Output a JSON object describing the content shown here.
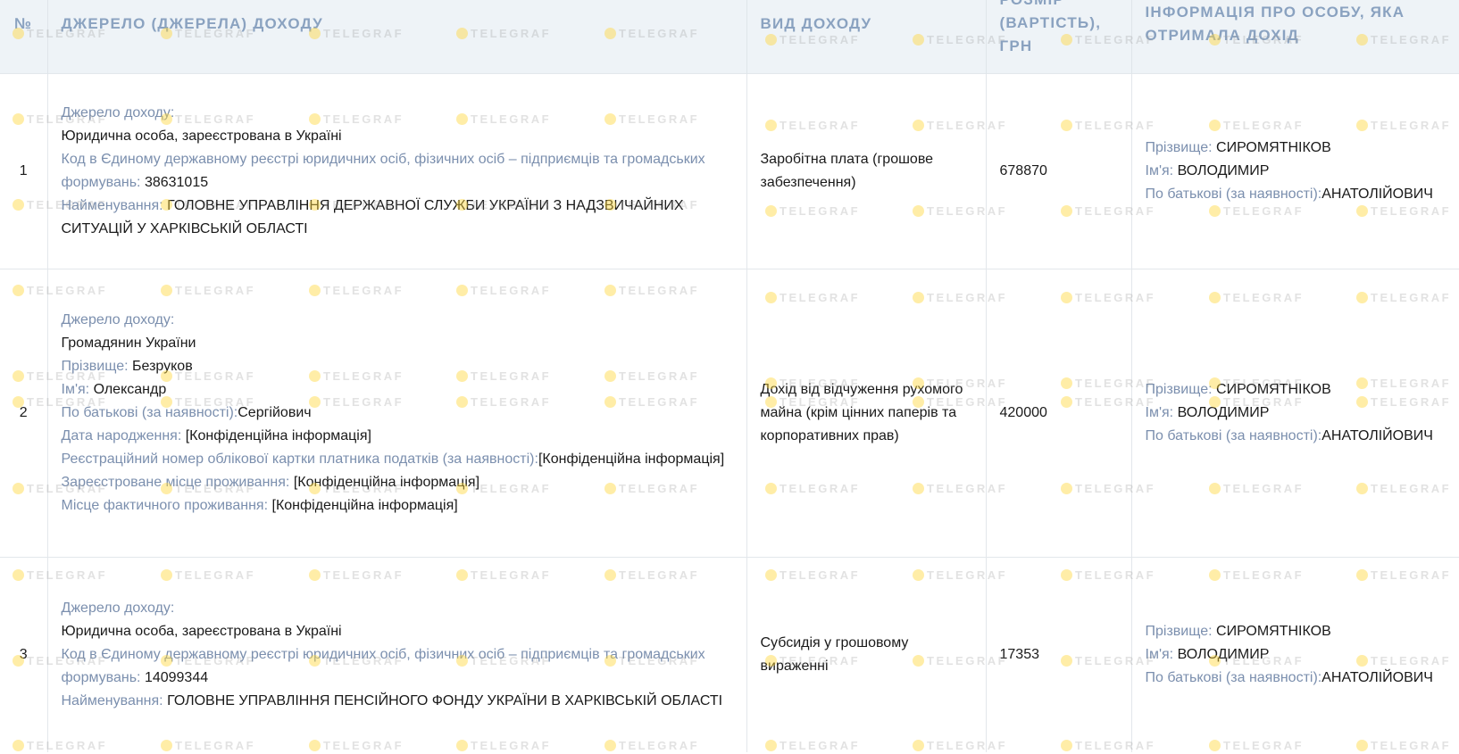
{
  "headers": {
    "num": "№",
    "source": "ДЖЕРЕЛО (ДЖЕРЕЛА) ДОХОДУ",
    "type": "ВИД ДОХОДУ",
    "amount": "РОЗМІР (ВАРТІСТЬ), ГРН",
    "person": "ІНФОРМАЦІЯ ПРО ОСОБУ, ЯКА ОТРИМАЛА ДОХІД"
  },
  "watermark": "TELEGRAF",
  "rows": [
    {
      "num": "1",
      "source": {
        "label_source": "Джерело доходу:",
        "source_value": "Юридична особа, зареєстрована в Україні",
        "label_code": "Код в Єдиному державному реєстрі юридичних осіб, фізичних осіб – підприємців та громадських формувань:",
        "code_value": "38631015",
        "label_name": "Найменування:",
        "name_value": "ГОЛОВНЕ УПРАВЛІННЯ ДЕРЖАВНОЇ СЛУЖБИ УКРАЇНИ З НАДЗВИЧАЙНИХ СИТУАЦІЙ У ХАРКІВСЬКІЙ ОБЛАСТІ"
      },
      "type": "Заробітна плата (грошове забезпечення)",
      "amount": "678870",
      "person": {
        "label_surname": "Прізвище:",
        "surname": "СИРОМЯТНІКОВ",
        "label_name": "Ім'я:",
        "name": "ВОЛОДИМИР",
        "label_patronymic": "По батькові (за наявності):",
        "patronymic": "АНАТОЛІЙОВИЧ"
      }
    },
    {
      "num": "2",
      "source": {
        "label_source": "Джерело доходу:",
        "source_value": "Громадянин України",
        "label_surname": "Прізвище:",
        "surname": "Безруков",
        "label_name": "Ім'я:",
        "name": "Олександр",
        "label_patronymic": "По батькові (за наявності):",
        "patronymic": "Сергійович",
        "label_birth": "Дата народження:",
        "birth": "[Конфіденційна інформація]",
        "label_tax": "Реєстраційний номер облікової картки платника податків (за наявності):",
        "tax": "[Конфіденційна інформація]",
        "label_reg_place": "Зареєстроване місце проживання:",
        "reg_place": "[Конфіденційна інформація]",
        "label_actual_place": "Місце фактичного проживання:",
        "actual_place": "[Конфіденційна інформація]"
      },
      "type": "Дохід від відчуження рухомого майна (крім цінних паперів та корпоративних прав)",
      "amount": "420000",
      "person": {
        "label_surname": "Прізвище:",
        "surname": "СИРОМЯТНІКОВ",
        "label_name": "Ім'я:",
        "name": "ВОЛОДИМИР",
        "label_patronymic": "По батькові (за наявності):",
        "patronymic": "АНАТОЛІЙОВИЧ"
      }
    },
    {
      "num": "3",
      "source": {
        "label_source": "Джерело доходу:",
        "source_value": "Юридична особа, зареєстрована в Україні",
        "label_code": "Код в Єдиному державному реєстрі юридичних осіб, фізичних осіб – підприємців та громадських формувань:",
        "code_value": "14099344",
        "label_name": "Найменування:",
        "name_value": "ГОЛОВНЕ УПРАВЛІННЯ ПЕНСІЙНОГО ФОНДУ УКРАЇНИ В ХАРКІВСЬКІЙ ОБЛАСТІ"
      },
      "type": "Субсидія у грошовому вираженні",
      "amount": "17353",
      "person": {
        "label_surname": "Прізвище:",
        "surname": "СИРОМЯТНІКОВ",
        "label_name": "Ім'я:",
        "name": "ВОЛОДИМИР",
        "label_patronymic": "По батькові (за наявності):",
        "patronymic": "АНАТОЛІЙОВИЧ"
      }
    }
  ]
}
